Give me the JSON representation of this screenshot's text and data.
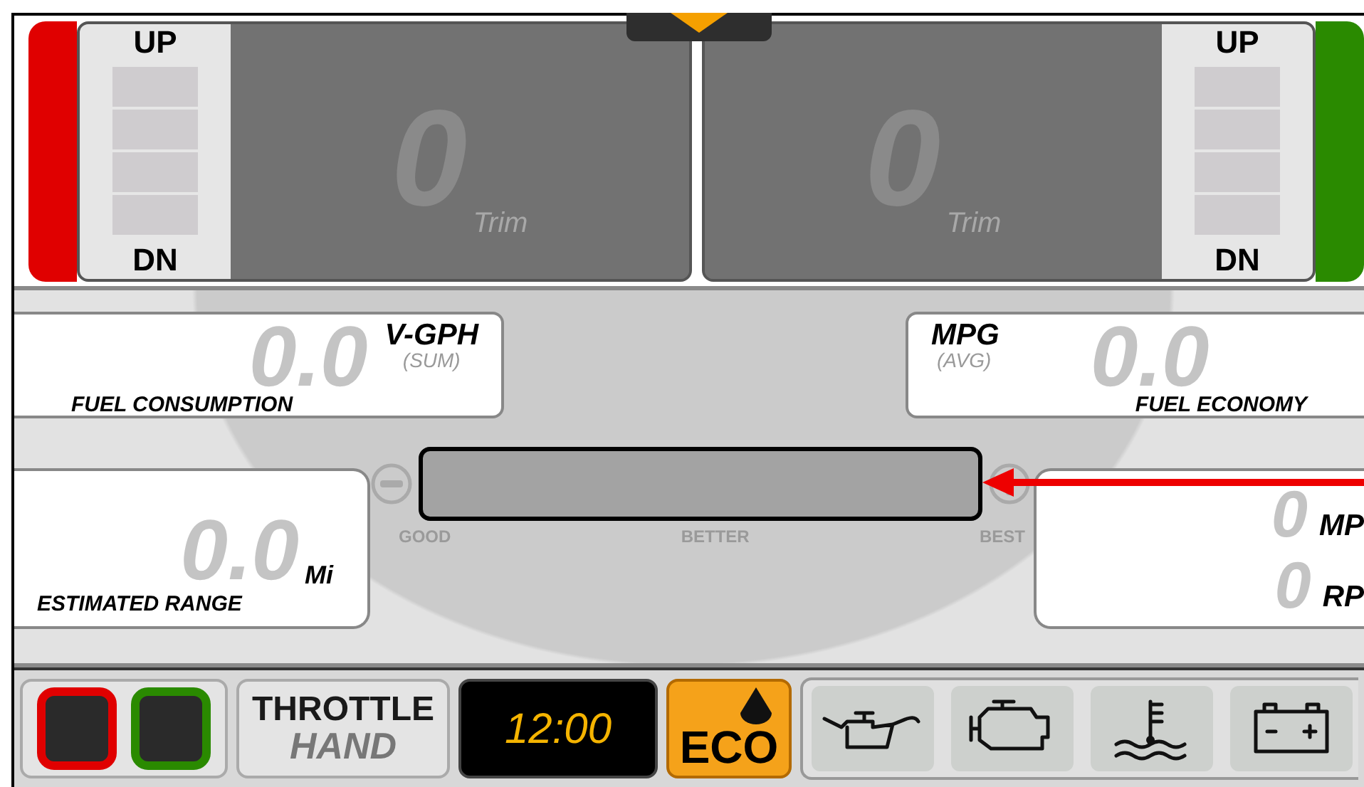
{
  "trim_gauges": [
    {
      "kind": "left",
      "color": "#e00000",
      "up_label": "UP",
      "down_label": "DN",
      "value": "0",
      "unit": "Trim"
    },
    {
      "kind": "right",
      "color": "#2a8a00",
      "up_label": "UP",
      "down_label": "DN",
      "value": "0",
      "unit": "Trim"
    }
  ],
  "readouts": {
    "fuel_consumption": {
      "value": "0.0",
      "unit": "V-GPH",
      "qualifier": "(SUM)",
      "label": "FUEL CONSUMPTION"
    },
    "fuel_economy": {
      "value": "0.0",
      "unit": "MPG",
      "qualifier": "(AVG)",
      "label": "FUEL ECONOMY"
    },
    "estimated_range": {
      "value": "0.0",
      "unit": "Mi",
      "label": "ESTIMATED RANGE"
    },
    "speed": {
      "value": "0",
      "unit": "MP"
    },
    "engine_speed": {
      "value": "0",
      "unit": "RP"
    }
  },
  "eco_meter": {
    "labels": [
      "GOOD",
      "BETTER",
      "BEST"
    ]
  },
  "status_bar": {
    "engine_indicators": [
      {
        "color": "#e00000"
      },
      {
        "color": "#2a8a00"
      }
    ],
    "throttle": {
      "title": "THROTTLE",
      "mode": "HAND"
    },
    "clock": "12:00",
    "eco": {
      "label": "ECO",
      "on": true
    },
    "warnings": [
      {
        "kind": "oil"
      },
      {
        "kind": "engine"
      },
      {
        "kind": "coolant"
      },
      {
        "kind": "battery"
      }
    ]
  }
}
